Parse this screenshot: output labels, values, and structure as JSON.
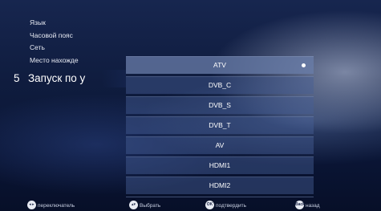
{
  "left_menu": {
    "items": [
      {
        "label": "Язык"
      },
      {
        "label": "Часовой пояс"
      },
      {
        "label": "Сеть"
      },
      {
        "label": "Место нахожде"
      }
    ]
  },
  "current_item": {
    "number": "5",
    "label": "Запуск по у"
  },
  "source_list": {
    "selected_index": 0,
    "items": [
      {
        "label": "ATV"
      },
      {
        "label": "DVB_C"
      },
      {
        "label": "DVB_S"
      },
      {
        "label": "DVB_T"
      },
      {
        "label": "AV"
      },
      {
        "label": "HDMI1"
      },
      {
        "label": "HDMI2"
      }
    ]
  },
  "hints": {
    "switch": {
      "icon_name": "left-right-arrows-icon",
      "icon_glyph": "◂ ▸",
      "label": "переключатель"
    },
    "select": {
      "icon_name": "up-down-arrows-icon",
      "icon_glyph": "▴▾",
      "label": "Выбрать"
    },
    "confirm": {
      "icon_name": "ok-button-icon",
      "icon_glyph": "OK",
      "label": "подтвердить"
    },
    "back": {
      "icon_name": "back-button-icon",
      "icon_glyph": "Back",
      "label": "назад"
    }
  },
  "colors": {
    "background": "#0f1c3e",
    "list_item": "#465f96",
    "list_item_selected": "#697daa",
    "text": "#ffffff"
  }
}
